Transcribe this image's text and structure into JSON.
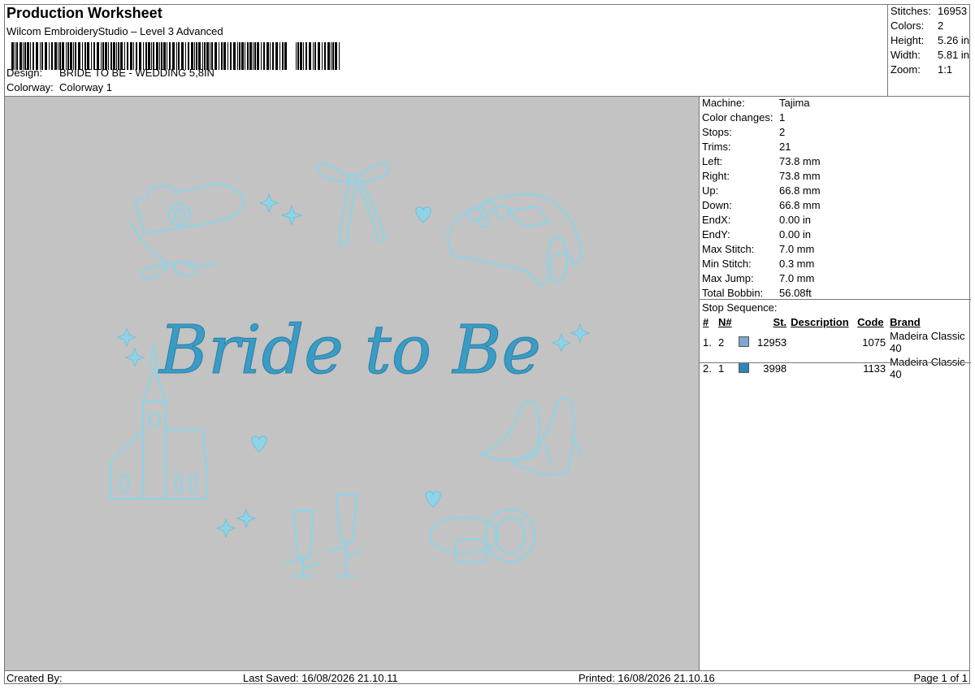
{
  "header": {
    "title": "Production Worksheet",
    "software": "Wilcom EmbroideryStudio – Level 3 Advanced",
    "design_label": "Design:",
    "design_value": "BRIDE TO BE - WEDDING 5,8IN",
    "colorway_label": "Colorway:",
    "colorway_value": "Colorway 1"
  },
  "summary": [
    {
      "label": "Stitches:",
      "value": "16953"
    },
    {
      "label": "Colors:",
      "value": "2"
    },
    {
      "label": "Height:",
      "value": "5.26 in"
    },
    {
      "label": "Width:",
      "value": "5.81 in"
    },
    {
      "label": "Zoom:",
      "value": "1:1"
    }
  ],
  "machine_info": [
    {
      "label": "Machine:",
      "value": "Tajima"
    },
    {
      "label": "Color changes:",
      "value": "1"
    },
    {
      "label": "Stops:",
      "value": "2"
    },
    {
      "label": "Trims:",
      "value": "21"
    },
    {
      "label": "Left:",
      "value": "73.8 mm"
    },
    {
      "label": "Right:",
      "value": "73.8 mm"
    },
    {
      "label": "Up:",
      "value": "66.8 mm"
    },
    {
      "label": "Down:",
      "value": "66.8 mm"
    },
    {
      "label": "EndX:",
      "value": "0.00 in"
    },
    {
      "label": "EndY:",
      "value": "0.00 in"
    },
    {
      "label": "Max Stitch:",
      "value": "7.0 mm"
    },
    {
      "label": "Min Stitch:",
      "value": "0.3 mm"
    },
    {
      "label": "Max Jump:",
      "value": "7.0 mm"
    },
    {
      "label": "Total Bobbin:",
      "value": "56.08ft"
    }
  ],
  "stop_sequence": {
    "title": "Stop Sequence:",
    "headers": [
      "#",
      "N#",
      "St.",
      "Description",
      "Code",
      "Brand"
    ],
    "rows": [
      {
        "index": "1.",
        "n": "2",
        "color": "#7fa7cf",
        "st": "12953",
        "description": "",
        "code": "1075",
        "brand": "Madeira Classic 40"
      },
      {
        "index": "2.",
        "n": "1",
        "color": "#2e86b8",
        "st": "3998",
        "description": "",
        "code": "1133",
        "brand": "Madeira Classic 40"
      }
    ]
  },
  "design_text": "Bride to Be",
  "colors": {
    "thread_light": "#8fd3e6",
    "thread_dark": "#3a9cc4",
    "canvas": "#c3c3c3"
  },
  "footer": {
    "created_by": "Created By:",
    "last_saved": "Last Saved: 16/08/2026 21.10.11",
    "printed": "Printed: 16/08/2026 21.10.16",
    "page": "Page 1 of 1"
  }
}
